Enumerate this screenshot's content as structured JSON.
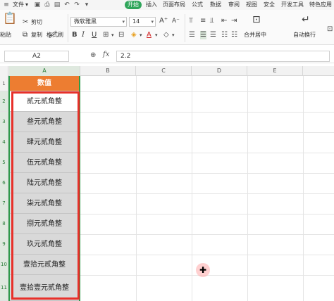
{
  "menubar": {
    "file": "文件",
    "tabs": [
      "开始",
      "插入",
      "页面布局",
      "公式",
      "数据",
      "审阅",
      "视图",
      "安全",
      "开发工具",
      "特色应用"
    ],
    "active_tab": "开始"
  },
  "ribbon": {
    "paste": "粘贴",
    "cut": "剪切",
    "copy": "复制",
    "format_painter": "格式刷",
    "font_name": "微软雅黑",
    "font_size": "14",
    "bold": "B",
    "italic": "I",
    "underline": "U",
    "merge_center": "合并居中",
    "wrap_text": "自动换行"
  },
  "formula_bar": {
    "cell_ref": "A2",
    "fx": "fx",
    "value": "2.2"
  },
  "grid": {
    "columns": [
      "A",
      "B",
      "C",
      "D",
      "E"
    ],
    "selected_column": "A",
    "rows": [
      "1",
      "2",
      "3",
      "4",
      "5",
      "6",
      "7",
      "8",
      "9",
      "10",
      "11"
    ],
    "column_a_header": "数值",
    "column_a_values": [
      "贰元贰角整",
      "叁元贰角整",
      "肆元贰角整",
      "伍元贰角整",
      "陆元贰角整",
      "柒元贰角整",
      "捌元贰角整",
      "玖元贰角整",
      "壹拾元贰角整",
      "壹拾壹元贰角整"
    ]
  },
  "colors": {
    "header_fill": "#ed7d31",
    "highlight_border": "#e8302a",
    "selection_green": "#2e9b4a",
    "active_tab": "#2fa55a"
  }
}
